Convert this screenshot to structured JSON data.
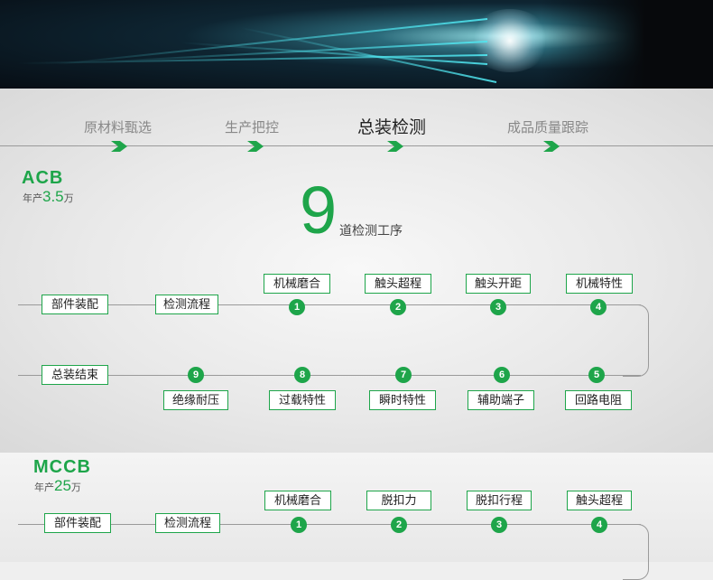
{
  "tabs": [
    {
      "label": "原材料甄选"
    },
    {
      "label": "生产把控"
    },
    {
      "label": "总装检测"
    },
    {
      "label": "成品质量跟踪"
    }
  ],
  "acb": {
    "brand": "ACB",
    "cap_prefix": "年产",
    "cap_num": "3.5",
    "cap_unit": "万",
    "big_number": "9",
    "big_caption": "道检测工序",
    "start": "部件装配",
    "flow": "检测流程",
    "end": "总装结束",
    "top_steps": [
      {
        "n": "1",
        "label": "机械磨合"
      },
      {
        "n": "2",
        "label": "触头超程"
      },
      {
        "n": "3",
        "label": "触头开距"
      },
      {
        "n": "4",
        "label": "机械特性"
      }
    ],
    "bottom_steps": [
      {
        "n": "9",
        "label": "绝缘耐压"
      },
      {
        "n": "8",
        "label": "过载特性"
      },
      {
        "n": "7",
        "label": "瞬时特性"
      },
      {
        "n": "6",
        "label": "辅助端子"
      },
      {
        "n": "5",
        "label": "回路电阻"
      }
    ]
  },
  "mccb": {
    "brand": "MCCB",
    "cap_prefix": "年产",
    "cap_num": "25",
    "cap_unit": "万",
    "start": "部件装配",
    "flow": "检测流程",
    "top_steps": [
      {
        "n": "1",
        "label": "机械磨合"
      },
      {
        "n": "2",
        "label": "脱扣力"
      },
      {
        "n": "3",
        "label": "脱扣行程"
      },
      {
        "n": "4",
        "label": "触头超程"
      }
    ]
  },
  "colors": {
    "accent": "#1ea54a"
  }
}
